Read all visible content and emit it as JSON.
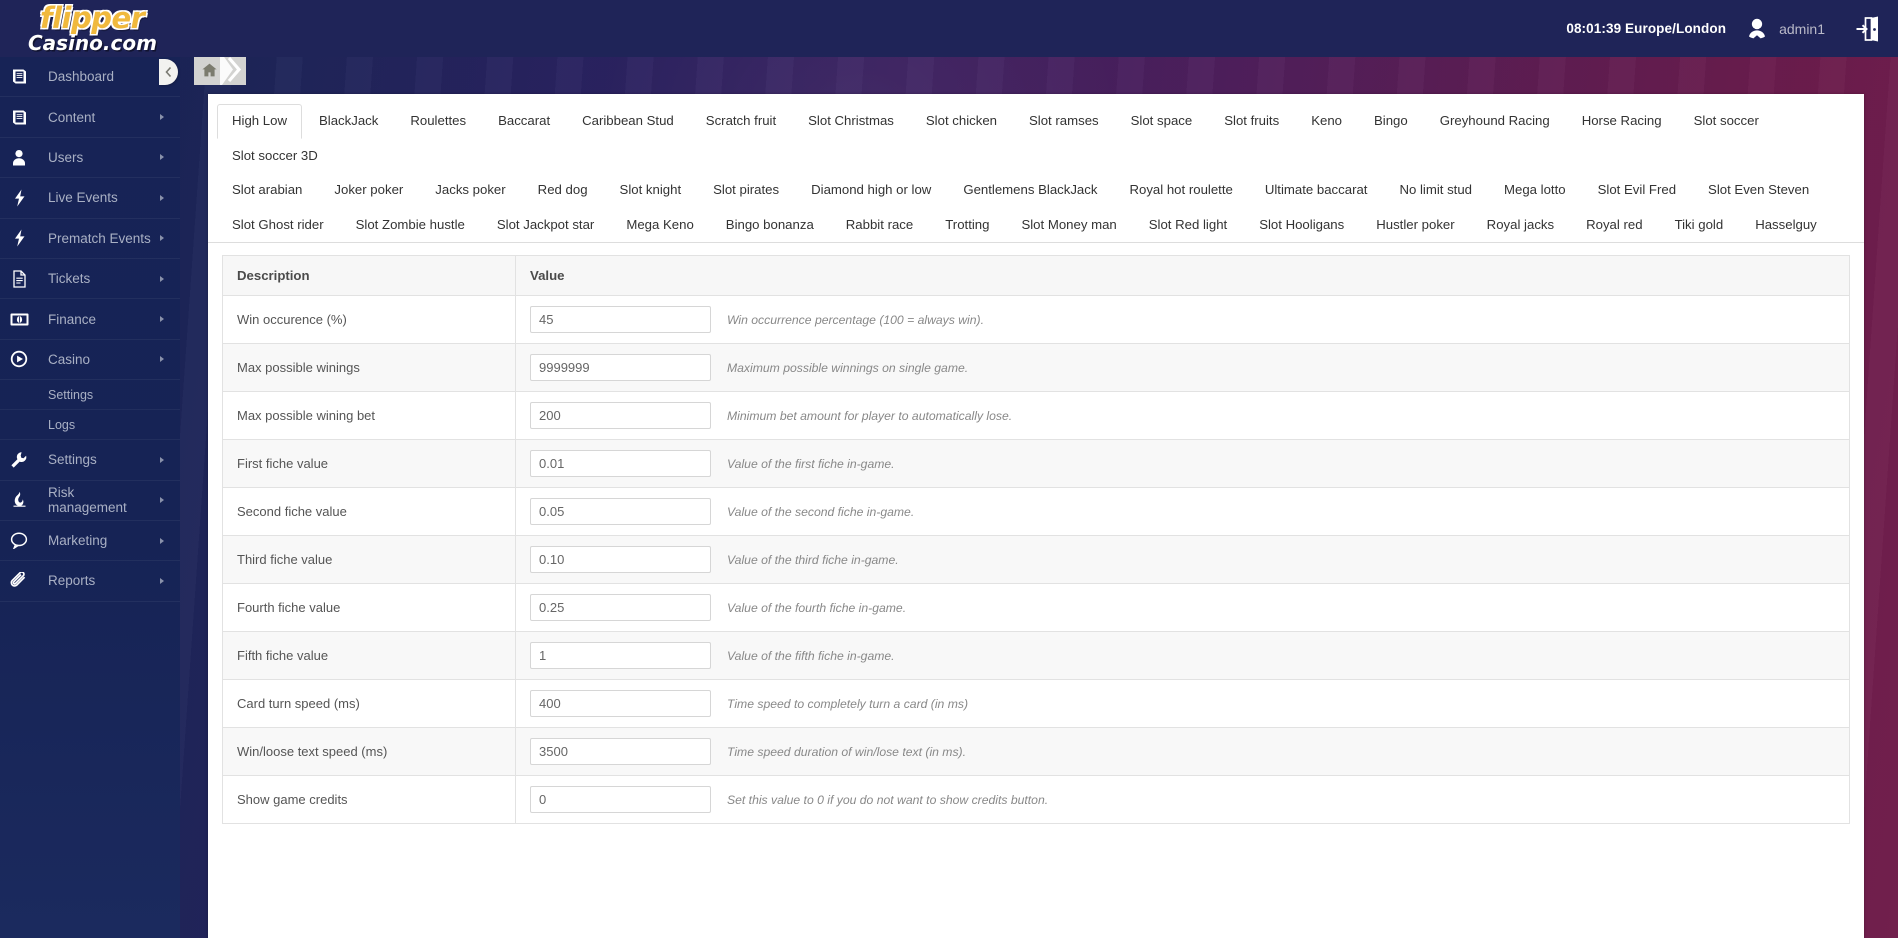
{
  "header": {
    "logo_line1": "flipper",
    "logo_line2": "Casino.com",
    "time": "08:01:39 Europe/London",
    "username": "admin1",
    "avatar_icon": "user-avatar-icon",
    "logout_icon": "logout-door-icon"
  },
  "sidebar": {
    "collapse_icon": "chevron-left-icon",
    "items": [
      {
        "label": "Dashboard",
        "icon": "book-icon",
        "has_arrow": true
      },
      {
        "label": "Content",
        "icon": "book-icon",
        "has_arrow": true
      },
      {
        "label": "Users",
        "icon": "user-icon",
        "has_arrow": true
      },
      {
        "label": "Live Events",
        "icon": "bolt-icon",
        "has_arrow": true
      },
      {
        "label": "Prematch Events",
        "icon": "bolt-icon",
        "has_arrow": true
      },
      {
        "label": "Tickets",
        "icon": "document-icon",
        "has_arrow": true
      },
      {
        "label": "Finance",
        "icon": "banknote-icon",
        "has_arrow": true
      },
      {
        "label": "Casino",
        "icon": "play-circle-icon",
        "has_arrow": true
      }
    ],
    "casino_submenu": [
      {
        "label": "Settings"
      },
      {
        "label": "Logs"
      }
    ],
    "items_after": [
      {
        "label": "Settings",
        "icon": "wrench-icon",
        "has_arrow": true
      },
      {
        "label": "Risk management",
        "icon": "flame-icon",
        "has_arrow": true
      },
      {
        "label": "Marketing",
        "icon": "speech-bubble-icon",
        "has_arrow": true
      },
      {
        "label": "Reports",
        "icon": "paperclip-icon",
        "has_arrow": true
      }
    ]
  },
  "breadcrumb": {
    "home_icon": "home-icon",
    "chevron_icon": "chevron-right-icon"
  },
  "tabs": {
    "active": "High Low",
    "row1": [
      "High Low",
      "BlackJack",
      "Roulettes",
      "Baccarat",
      "Caribbean Stud",
      "Scratch fruit",
      "Slot Christmas",
      "Slot chicken",
      "Slot ramses",
      "Slot space",
      "Slot fruits",
      "Keno",
      "Bingo",
      "Greyhound Racing",
      "Horse Racing",
      "Slot soccer",
      "Slot soccer 3D"
    ],
    "row2": [
      "Slot arabian",
      "Joker poker",
      "Jacks poker",
      "Red dog",
      "Slot knight",
      "Slot pirates",
      "Diamond high or low",
      "Gentlemens BlackJack",
      "Royal hot roulette",
      "Ultimate baccarat",
      "No limit stud",
      "Mega lotto",
      "Slot Evil Fred",
      "Slot Even Steven"
    ],
    "row3": [
      "Slot Ghost rider",
      "Slot Zombie hustle",
      "Slot Jackpot star",
      "Mega Keno",
      "Bingo bonanza",
      "Rabbit race",
      "Trotting",
      "Slot Money man",
      "Slot Red light",
      "Slot Hooligans",
      "Hustler poker",
      "Royal jacks",
      "Royal red",
      "Tiki gold",
      "Hasselguy"
    ]
  },
  "table": {
    "columns": [
      "Description",
      "Value"
    ],
    "rows": [
      {
        "description": "Win occurence (%)",
        "value": "45",
        "hint": "Win occurrence percentage (100 = always win)."
      },
      {
        "description": "Max possible winings",
        "value": "9999999",
        "hint": "Maximum possible winnings on single game."
      },
      {
        "description": "Max possible wining bet",
        "value": "200",
        "hint": "Minimum bet amount for player to automatically lose."
      },
      {
        "description": "First fiche value",
        "value": "0.01",
        "hint": "Value of the first fiche in-game."
      },
      {
        "description": "Second fiche value",
        "value": "0.05",
        "hint": "Value of the second fiche in-game."
      },
      {
        "description": "Third fiche value",
        "value": "0.10",
        "hint": "Value of the third fiche in-game."
      },
      {
        "description": "Fourth fiche value",
        "value": "0.25",
        "hint": "Value of the fourth fiche in-game."
      },
      {
        "description": "Fifth fiche value",
        "value": "1",
        "hint": "Value of the fifth fiche in-game."
      },
      {
        "description": "Card turn speed (ms)",
        "value": "400",
        "hint": "Time speed to completely turn a card (in ms)"
      },
      {
        "description": "Win/loose text speed (ms)",
        "value": "3500",
        "hint": "Time speed duration of win/lose text (in ms)."
      },
      {
        "description": "Show game credits",
        "value": "0",
        "hint": "Set this value to 0 if you do not want to show credits button."
      }
    ]
  },
  "colors": {
    "sidebar_bg": "#172356",
    "header_bg": "#1f2458",
    "accent_yellow": "#f0b93d",
    "bg_left": "#152052",
    "bg_right": "#73204e"
  }
}
